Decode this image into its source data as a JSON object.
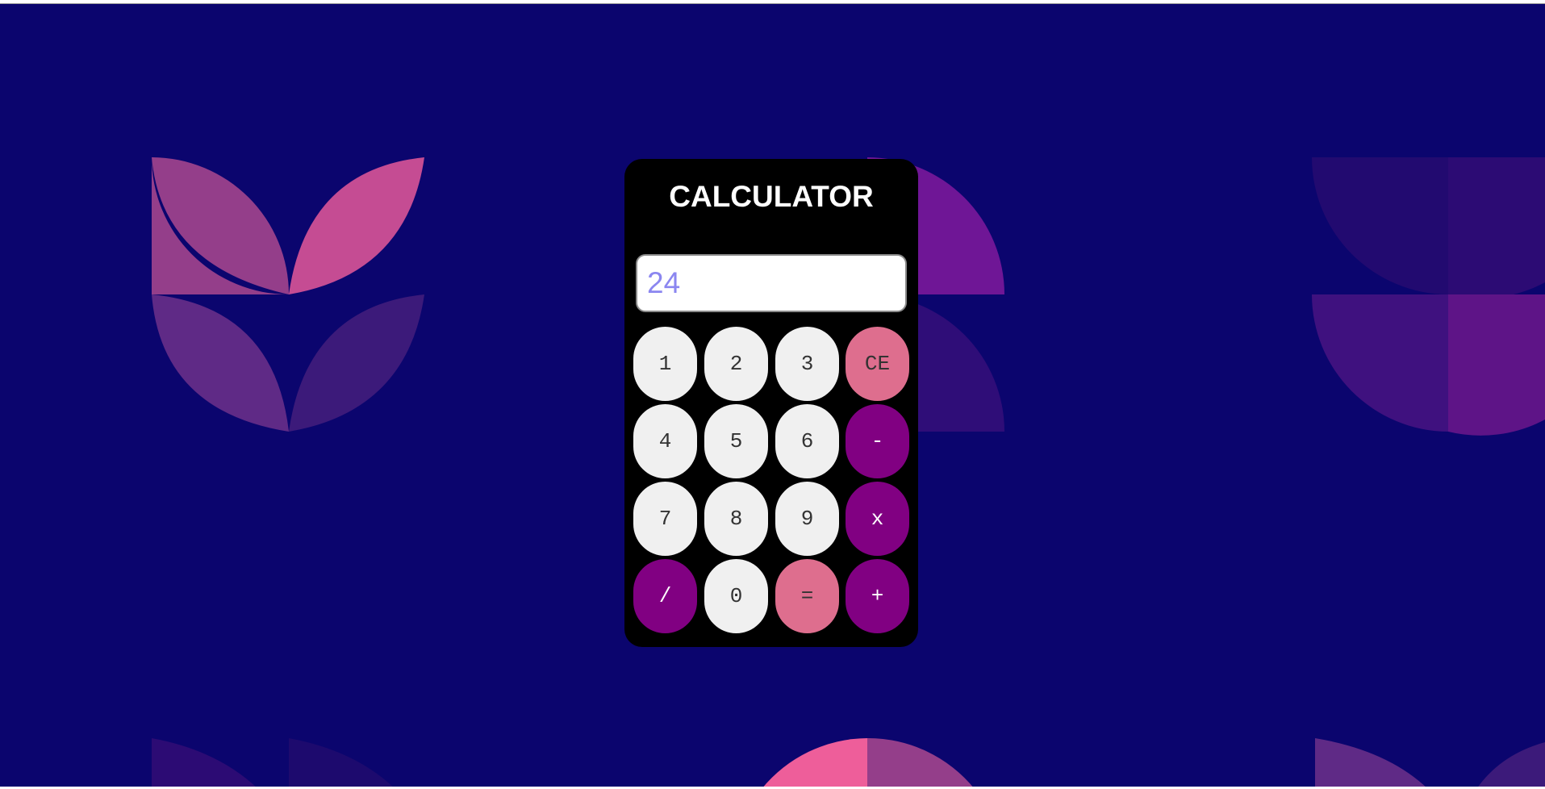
{
  "calculator": {
    "title": "CALCULATOR",
    "display_value": "24",
    "keys": {
      "k1": "1",
      "k2": "2",
      "k3": "3",
      "clear": "CE",
      "k4": "4",
      "k5": "5",
      "k6": "6",
      "subtract": "-",
      "k7": "7",
      "k8": "8",
      "k9": "9",
      "multiply": "x",
      "divide": "/",
      "k0": "0",
      "equals": "=",
      "add": "+"
    }
  },
  "colors": {
    "background": "#0b056e",
    "panel": "#000000",
    "number_key": "#f0f0f0",
    "pink_key": "#de6e8e",
    "operator_key": "#810082",
    "display_text": "#8b86f0"
  }
}
